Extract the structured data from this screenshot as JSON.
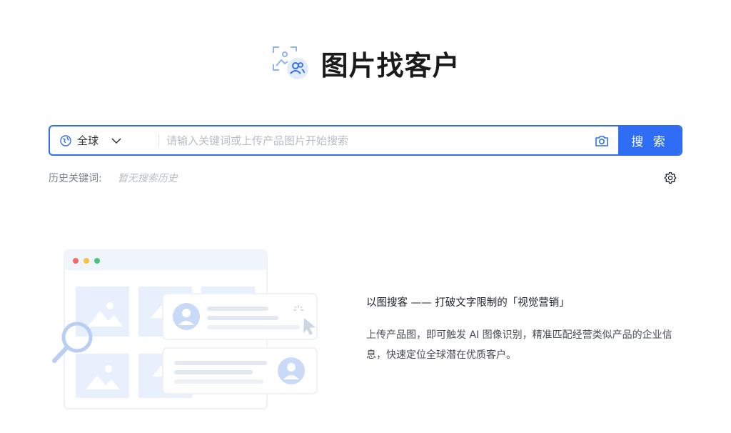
{
  "header": {
    "title": "图片找客户",
    "logo_icon": "image-search-user-icon"
  },
  "search": {
    "region_label": "全球",
    "placeholder": "请输入关键词或上传产品图片开始搜索",
    "value": "",
    "button_label": "搜 索",
    "camera_icon": "camera-icon",
    "globe_icon": "globe-icon",
    "chevron_icon": "chevron-down-icon"
  },
  "history": {
    "label": "历史关键词:",
    "empty_text": "暂无搜索历史",
    "settings_icon": "gear-icon"
  },
  "promo": {
    "title": "以图搜客 —— 打破文字限制的「视觉营销」",
    "description": "上传产品图，即可触发 AI 图像识别，精准匹配经营类似产品的企业信息，快速定位全球潜在优质客户。"
  },
  "colors": {
    "accent": "#2f6df5",
    "illustration_light": "#e8effd",
    "illustration_mid": "#c9daf8"
  }
}
